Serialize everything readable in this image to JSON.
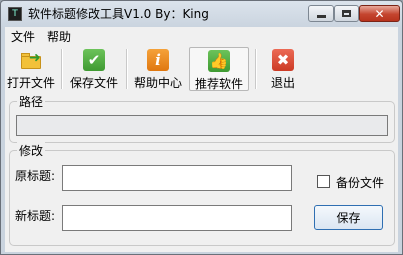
{
  "window": {
    "title": "软件标题修改工具V1.0 By：King",
    "icon": "app-icon"
  },
  "menubar": {
    "items": [
      "文件",
      "帮助"
    ]
  },
  "toolbar": {
    "buttons": [
      {
        "label": "打开文件",
        "icon": "open-folder-icon"
      },
      {
        "label": "保存文件",
        "icon": "save-check-icon"
      },
      {
        "label": "帮助中心",
        "icon": "info-icon"
      },
      {
        "label": "推荐软件",
        "icon": "recommend-icon"
      },
      {
        "label": "退出",
        "icon": "exit-icon"
      }
    ]
  },
  "path_group": {
    "legend": "路径",
    "value": ""
  },
  "edit_group": {
    "legend": "修改",
    "original_label": "原标题:",
    "original_value": "",
    "new_label": "新标题:",
    "new_value": "",
    "backup_label": "备份文件",
    "backup_checked": false,
    "save_label": "保存"
  },
  "colors": {
    "title_bar": "#c9d3de",
    "close_button": "#c4452f",
    "client_bg": "#f0f0f0",
    "save_button_border": "#2f6fb2"
  }
}
